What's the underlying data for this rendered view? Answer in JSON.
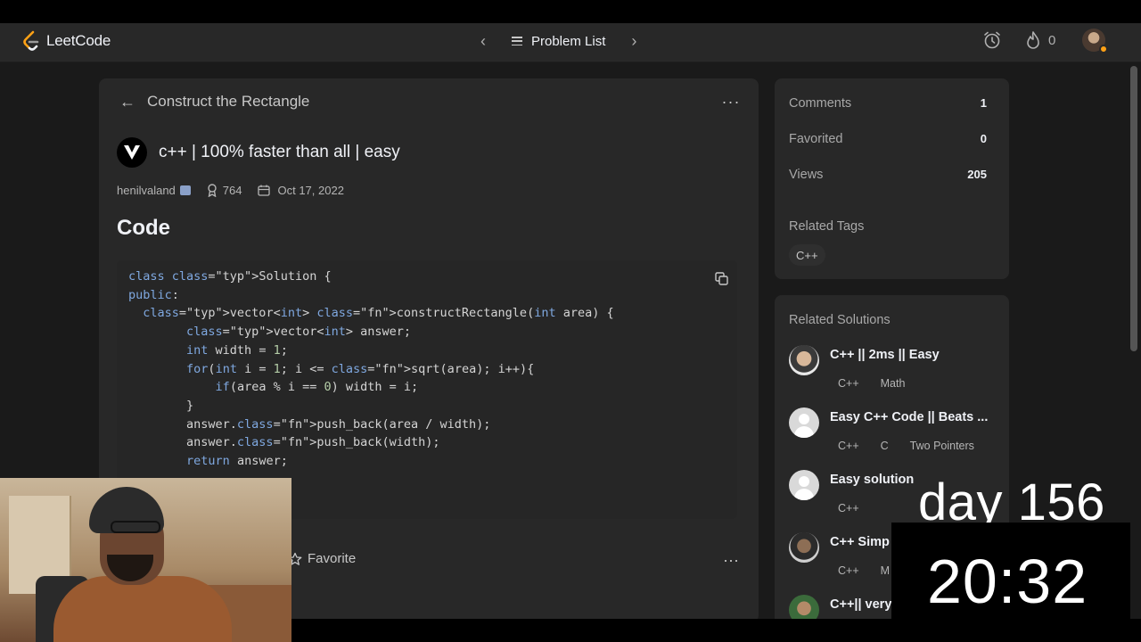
{
  "navbar": {
    "logo_text": "LeetCode",
    "problem_list_label": "Problem List",
    "streak_count": "0",
    "icons": [
      "leetcode-logo-icon",
      "chevron-left-icon",
      "list-icon",
      "chevron-right-icon",
      "alarm-clock-icon",
      "fire-icon"
    ]
  },
  "main": {
    "problem_title": "Construct the Rectangle",
    "solution_title": "c++ | 100% faster than all | easy",
    "author": "henilvaland",
    "reputation": "764",
    "date": "Oct 17, 2022",
    "code_heading": "Code",
    "code_lines": [
      "class Solution {",
      "public:",
      "  vector<int> constructRectangle(int area) {",
      "        vector<int> answer;",
      "        int width = 1;",
      "        for(int i = 1; i <= sqrt(area); i++){",
      "            if(area % i == 0) width = i;",
      "        }",
      "        answer.push_back(area / width);",
      "        answer.push_back(width);",
      "        return answer;"
    ],
    "favorite_label": "Favorite"
  },
  "stats": {
    "comments_label": "Comments",
    "comments_value": "1",
    "favorited_label": "Favorited",
    "favorited_value": "0",
    "views_label": "Views",
    "views_value": "205",
    "related_tags_label": "Related Tags",
    "tags": [
      "C++"
    ]
  },
  "related": {
    "title": "Related Solutions",
    "items": [
      {
        "name": "C++ || 2ms || Easy",
        "tags": [
          "C++",
          "Math"
        ]
      },
      {
        "name": "Easy C++ Code || Beats ...",
        "tags": [
          "C++",
          "C",
          "Two Pointers"
        ]
      },
      {
        "name": "Easy solution",
        "tags": [
          "C++"
        ]
      },
      {
        "name": "C++ Simp",
        "tags": [
          "C++",
          "M"
        ]
      },
      {
        "name": "C++|| very",
        "tags": []
      }
    ]
  },
  "overlay": {
    "day_label": "day 156",
    "timer": "20:32"
  },
  "colors": {
    "accent": "#ffa116",
    "background": "#1a1a1a",
    "card": "#282828"
  }
}
